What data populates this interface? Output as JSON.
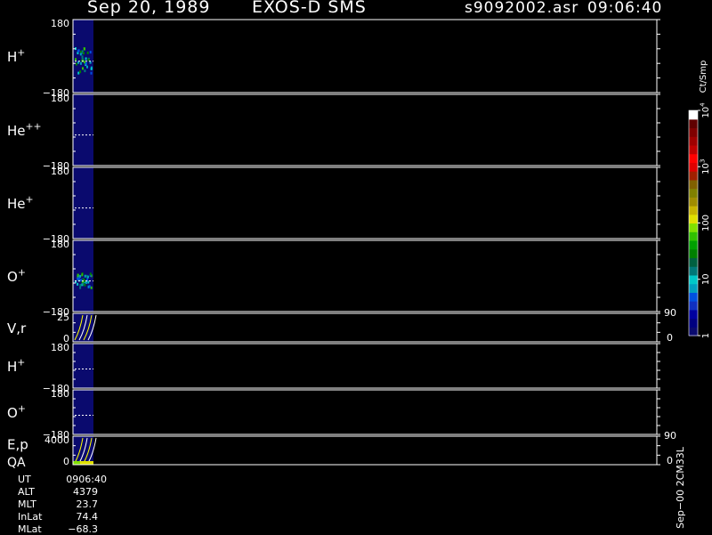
{
  "header": {
    "date": "Sep 20, 1989",
    "mission": "EXOS-D SMS",
    "file": "s9092002.asr",
    "time": "09:06:40"
  },
  "chart_data": {
    "type": "heatmap",
    "panels": [
      {
        "label": "H",
        "sup": "+",
        "ymax": "180",
        "ymin": "−180",
        "blob": "H"
      },
      {
        "label": "He",
        "sup": "++",
        "ymax": "180",
        "ymin": "−180",
        "blob": ""
      },
      {
        "label": "He",
        "sup": "+",
        "ymax": "180",
        "ymin": "−180",
        "blob": ""
      },
      {
        "label": "O",
        "sup": "+",
        "ymax": "180",
        "ymin": "−180",
        "blob": "O"
      },
      {
        "label": "V,r",
        "sup": "",
        "ymax": "25",
        "ymin": "0",
        "line": true,
        "rmax": "90",
        "rmin": "0"
      },
      {
        "label": "H",
        "sup": "+",
        "ymax": "180",
        "ymin": "−180",
        "blob": ""
      },
      {
        "label": "O",
        "sup": "+",
        "ymax": "180",
        "ymin": "−180",
        "blob": ""
      },
      {
        "label": "E,p",
        "sup": "",
        "label2": "QA",
        "ymax": "4000",
        "ymin": "0",
        "line": true,
        "rmax": "90",
        "rmin": "0"
      }
    ],
    "colorbar": {
      "title": "Ct/Smp",
      "ticks": [
        {
          "text": "10",
          "sup": "4",
          "frac": 1.0
        },
        {
          "text": "10",
          "sup": "3",
          "frac": 0.75
        },
        {
          "text": "100",
          "sup": "",
          "frac": 0.5
        },
        {
          "text": "10",
          "sup": "",
          "frac": 0.25
        },
        {
          "text": "1",
          "sup": "",
          "frac": 0.0
        }
      ],
      "colors": [
        "#0a0a6e",
        "#000080",
        "#0000a0",
        "#1030c0",
        "#0050e0",
        "#00a0c0",
        "#00c8c8",
        "#007878",
        "#006040",
        "#008000",
        "#00a000",
        "#30c000",
        "#80e000",
        "#e0e000",
        "#c8b400",
        "#a08c00",
        "#808000",
        "#806000",
        "#a02000",
        "#e00000",
        "#ff0000",
        "#c00000",
        "#a00000",
        "#800000",
        "#600000",
        "#ffffff"
      ]
    }
  },
  "footer": {
    "info": [
      {
        "key": "UT",
        "value": "0906:40"
      },
      {
        "key": "ALT",
        "value": "4379"
      },
      {
        "key": "MLT",
        "value": "23.7"
      },
      {
        "key": "InLat",
        "value": "74.4"
      },
      {
        "key": "MLat",
        "value": "−68.3"
      }
    ],
    "vertical_label": "Sep−00  2CM33L"
  },
  "colors": {
    "background": "#000000",
    "data_bg": "#0a0a6e",
    "axis": "#ffffff",
    "trace": "#ffff00"
  }
}
